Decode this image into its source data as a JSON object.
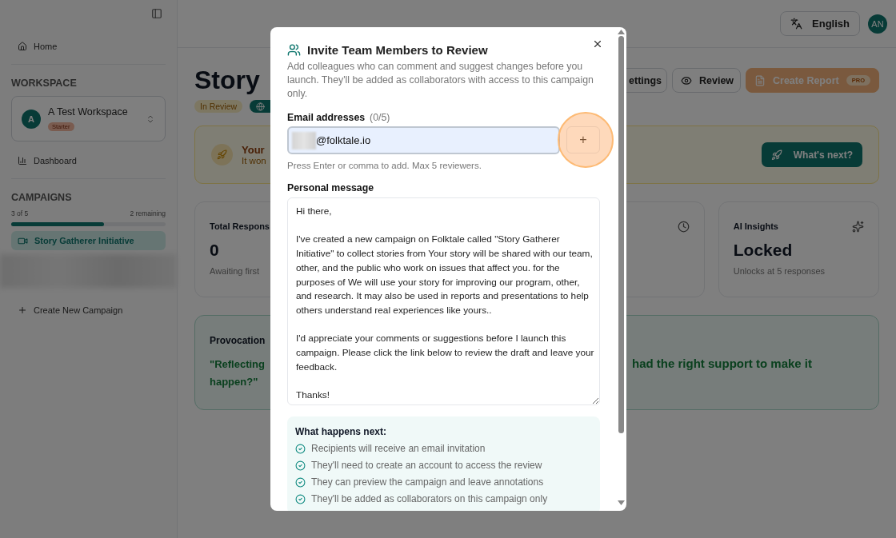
{
  "sidebar": {
    "nav": [
      {
        "label": "Home",
        "kind": "home"
      }
    ],
    "workspace": {
      "heading": "WORKSPACE",
      "avatar": "A",
      "name": "A Test Workspace",
      "plan": "Starter"
    },
    "links": [
      {
        "label": "Dashboard",
        "kind": "chart"
      }
    ],
    "campaigns": {
      "heading": "CAMPAIGNS",
      "used": "3 of 5",
      "remaining": "2 remaining",
      "level": 0.6,
      "items": [
        {
          "label": "Story Gatherer Initiative",
          "selected": true
        }
      ],
      "create": "Create New Campaign"
    }
  },
  "header": {
    "language": "English",
    "avatar": "AN"
  },
  "page": {
    "title": "Story",
    "badges": [
      {
        "kind": "status",
        "label": "In Review"
      },
      {
        "kind": "globe"
      }
    ],
    "actions": [
      {
        "kind": "settings",
        "label": "ettings"
      },
      {
        "kind": "review",
        "label": "Review"
      },
      {
        "kind": "report",
        "label": "Create Report",
        "badge": "PRO",
        "disabled": true
      }
    ],
    "banner": {
      "title": "Your",
      "text": "It won",
      "button": "What's next?"
    },
    "stats": [
      {
        "kind": "responses",
        "title": "Total Respons",
        "value": "0",
        "note": "Awaiting first"
      },
      {
        "kind": "time"
      },
      {
        "kind": "insights",
        "title": "AI Insights",
        "value": "Locked",
        "note": "Unlocks at 5 responses"
      }
    ],
    "provocation": {
      "title": "Provocation",
      "quote_left": [
        "\"Reflecting",
        "happen?\""
      ],
      "quote_right": "had the right support to make it"
    }
  },
  "modal": {
    "title": "Invite Team Members to Review",
    "description": "Add colleagues who can comment and suggest changes before you launch. They'll be added as collaborators with access to this campaign only.",
    "email_label": "Email addresses",
    "email_count": "(0/5)",
    "email_value": "@folktale.io",
    "add_button": "+",
    "hint": "Press Enter or comma to add. Max 5 reviewers.",
    "message_label": "Personal message",
    "message": "Hi there,\n\nI've created a new campaign on Folktale called \"Story Gatherer Initiative\" to collect stories from Your story will be shared with our team, other, and the public who work on issues that affect you. for the purposes of We will use your story for improving our program, other, and research. It may also be used in reports and presentations to help others understand real experiences like yours..\n\nI'd appreciate your comments or suggestions before I launch this campaign. Please click the link below to review the draft and leave your feedback.\n\nThanks!",
    "next_title": "What happens next:",
    "steps": [
      "Recipients will receive an email invitation",
      "They'll need to create an account to access the review",
      "They can preview the campaign and leave annotations",
      "They'll be added as collaborators on this campaign only"
    ]
  }
}
